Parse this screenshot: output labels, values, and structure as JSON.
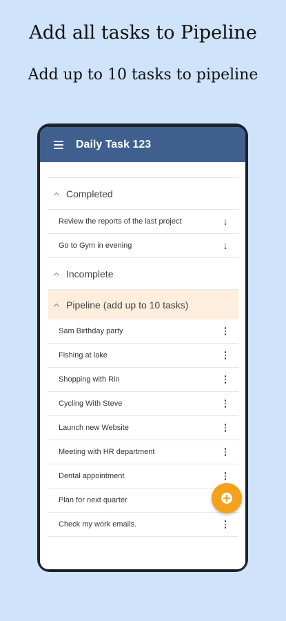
{
  "promo": {
    "title": "Add all tasks to Pipeline",
    "subtitle": "Add up to 10 tasks to pipeline"
  },
  "app": {
    "title": "Daily Task 123",
    "icons": {
      "menu": "hamburger-menu-icon",
      "fab": "add-circle-icon"
    }
  },
  "sections": {
    "completed": {
      "label": "Completed",
      "items": [
        "Review the reports of the last project",
        "Go to Gym in evening"
      ]
    },
    "incomplete": {
      "label": "Incomplete"
    },
    "pipeline": {
      "label": "Pipeline (add up to 10 tasks)",
      "items": [
        "Sam Birthday party",
        "Fishing at lake",
        "Shopping with Rin",
        "Cycling With Steve",
        "Launch new Website",
        "Meeting with HR department",
        "Dental appointment",
        "Plan for next quarter",
        "Check my work emails."
      ]
    }
  },
  "colors": {
    "background": "#cfe3fb",
    "appbar": "#3f5f8f",
    "pipeline_highlight": "#fdeedd",
    "fab": "#f6a11b"
  }
}
